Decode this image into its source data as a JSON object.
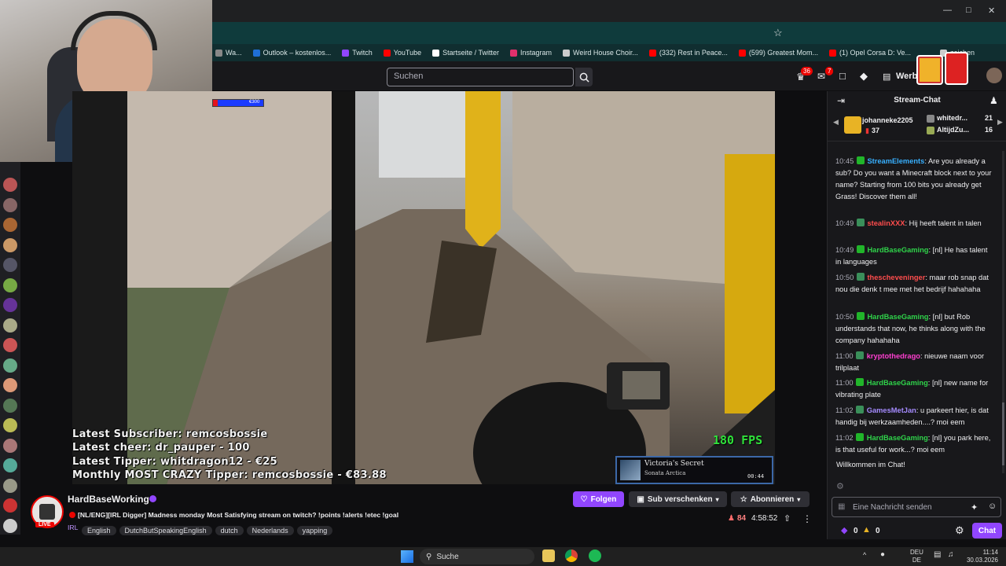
{
  "browser": {
    "bookmarks": [
      {
        "label": "Wa...",
        "icon": "bookmark-icon",
        "color": "#888888"
      },
      {
        "label": "Outlook – kostenlos...",
        "icon": "outlook-icon",
        "color": "#1f6fd6"
      },
      {
        "label": "Twitch",
        "icon": "twitch-icon",
        "color": "#9146ff"
      },
      {
        "label": "YouTube",
        "icon": "youtube-icon",
        "color": "#ff0000"
      },
      {
        "label": "Startseite / Twitter",
        "icon": "x-icon",
        "color": "#ffffff"
      },
      {
        "label": "Instagram",
        "icon": "instagram-icon",
        "color": "#e1306c"
      },
      {
        "label": "Weird House Choir...",
        "icon": "bookmark-icon",
        "color": "#cccccc"
      },
      {
        "label": "(332) Rest in Peace...",
        "icon": "youtube-icon",
        "color": "#ff0000"
      },
      {
        "label": "(599) Greatest Mom...",
        "icon": "youtube-icon",
        "color": "#ff0000"
      },
      {
        "label": "(1) Opel Corsa D: Ve...",
        "icon": "youtube-icon",
        "color": "#ff0000"
      },
      {
        "label": "zeichen",
        "icon": "folder-icon",
        "color": "#cccccc"
      }
    ]
  },
  "topnav": {
    "search_placeholder": "Suchen",
    "notifications_count": "36",
    "inbox_count": "7",
    "werbung_label": "Werb"
  },
  "overlay": {
    "progress_label": "€300",
    "progress_fraction": 0.09,
    "latest_subscriber": "Latest Subscriber: remcosbossie",
    "latest_cheer": "Latest cheer: dr_pauper - 100",
    "latest_tipper": "Latest Tipper: whitdragon12 - €25",
    "monthly_tipper": "Monthly MOST CRAZY Tipper: remcosbossie - €83.88",
    "fps": "180 FPS",
    "song_title": "Victoria's Secret",
    "song_artist": "Sonata Arctica",
    "song_time": "00:44"
  },
  "channel": {
    "name": "HardBaseWorking",
    "title": "[NL/ENG][IRL Digger] Madness monday Most Satisfying stream on twitch? !points !alerts !etec !goal",
    "category": "IRL",
    "tags": [
      "English",
      "DutchButSpeakingEnglish",
      "dutch",
      "Nederlands",
      "yapping"
    ],
    "live_label": "LIVE",
    "follow_label": "Folgen",
    "gift_label": "Sub verschenken",
    "subscribe_label": "Abonnieren",
    "viewers": "84",
    "uptime": "4:58:52"
  },
  "chat": {
    "header": "Stream-Chat",
    "leaderboard": [
      {
        "name": "johanneke2205",
        "count": "37"
      },
      {
        "name": "whitedr...",
        "count": "21"
      },
      {
        "name": "AltijdZu...",
        "count": "16"
      }
    ],
    "messages": [
      {
        "time": "10:45",
        "user": "StreamElements",
        "color": "#38b0ff",
        "text": ": Are you already a sub? Do you want a Minecraft block next to your name? Starting from 100 bits you already get Grass! Discover them all!"
      },
      {
        "time": "10:49",
        "user": "stealinXXX",
        "color": "#ff4d4d",
        "text": ": Hij heeft talent in talen"
      },
      {
        "time": "10:49",
        "user": "HardBaseGaming",
        "color": "#2fd34a",
        "text": ": [nl] He has talent in languages"
      },
      {
        "time": "10:50",
        "user": "thescheveninger",
        "color": "#ff4d4d",
        "text": ": maar rob snap dat nou die denk t mee met het bedrijf hahahaha"
      },
      {
        "time": "10:50",
        "user": "HardBaseGaming",
        "color": "#2fd34a",
        "text": ": [nl] but Rob understands that now, he thinks along with the company hahahaha"
      },
      {
        "time": "11:00",
        "user": "kryptothedrago",
        "color": "#ff3fd0",
        "text": ": nieuwe naam voor trilplaat"
      },
      {
        "time": "11:00",
        "user": "HardBaseGaming",
        "color": "#2fd34a",
        "text": ": [nl] new name for vibrating plate"
      },
      {
        "time": "11:02",
        "user": "GamesMetJan",
        "color": "#a58bff",
        "text": ": u parkeert hier, is dat handig bij werkzaamheden....? moi eem"
      },
      {
        "time": "11:02",
        "user": "HardBaseGaming",
        "color": "#2fd34a",
        "text": ": [nl] you park here, is that useful for work...? moi eem"
      }
    ],
    "welcome": "Willkommen im Chat!",
    "input_placeholder": "Eine Nachricht senden",
    "points": "0",
    "bits": "0",
    "chat_button": "Chat"
  },
  "taskbar": {
    "search_label": "Suche",
    "lang_top": "DEU",
    "lang_bottom": "DE",
    "time": "11:14",
    "date": "30.03.2026"
  },
  "colors": {
    "twitch_purple": "#9146ff",
    "live_red": "#eb0400",
    "bg_dark": "#0e0e10",
    "chat_bg": "#18181b"
  }
}
